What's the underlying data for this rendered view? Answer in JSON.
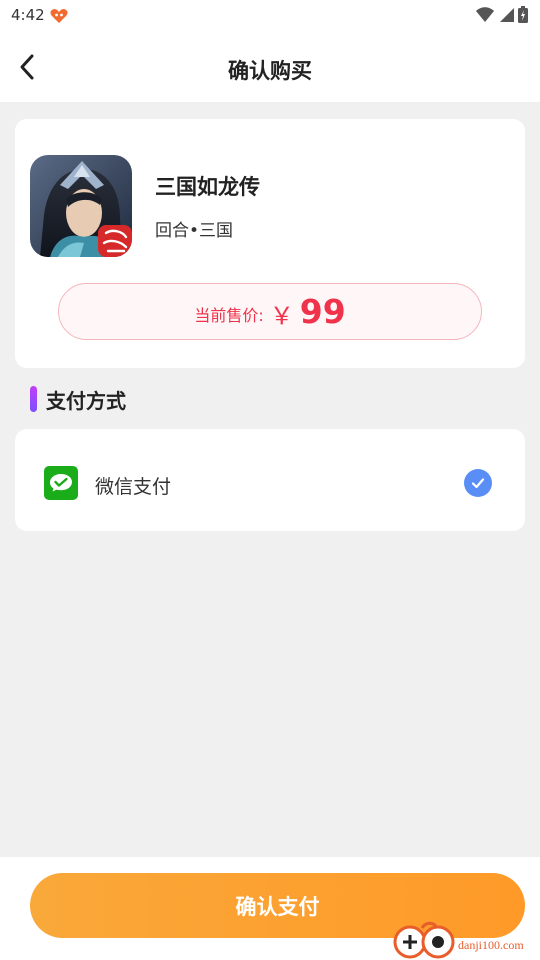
{
  "status_bar": {
    "time": "4:42",
    "icons": [
      "app-notification-icon",
      "wifi-icon",
      "signal-icon",
      "battery-icon"
    ]
  },
  "header": {
    "title": "确认购买",
    "back_icon": "chevron-left-icon"
  },
  "product": {
    "name": "三国如龙传",
    "tags": "回合•三国",
    "price_label": "当前售价:",
    "currency": "￥",
    "price": "99"
  },
  "payment": {
    "section_title": "支付方式",
    "methods": [
      {
        "label": "微信支付",
        "icon": "wechat-pay-icon",
        "selected": true
      }
    ]
  },
  "footer": {
    "confirm_label": "确认支付"
  },
  "watermark": {
    "text": "danji100.com"
  },
  "colors": {
    "accent_orange": "#ffa030",
    "price_red": "#f0324a",
    "check_blue": "#5a8ef7",
    "wechat_green": "#1aad19",
    "section_bar": "#a146f9"
  }
}
